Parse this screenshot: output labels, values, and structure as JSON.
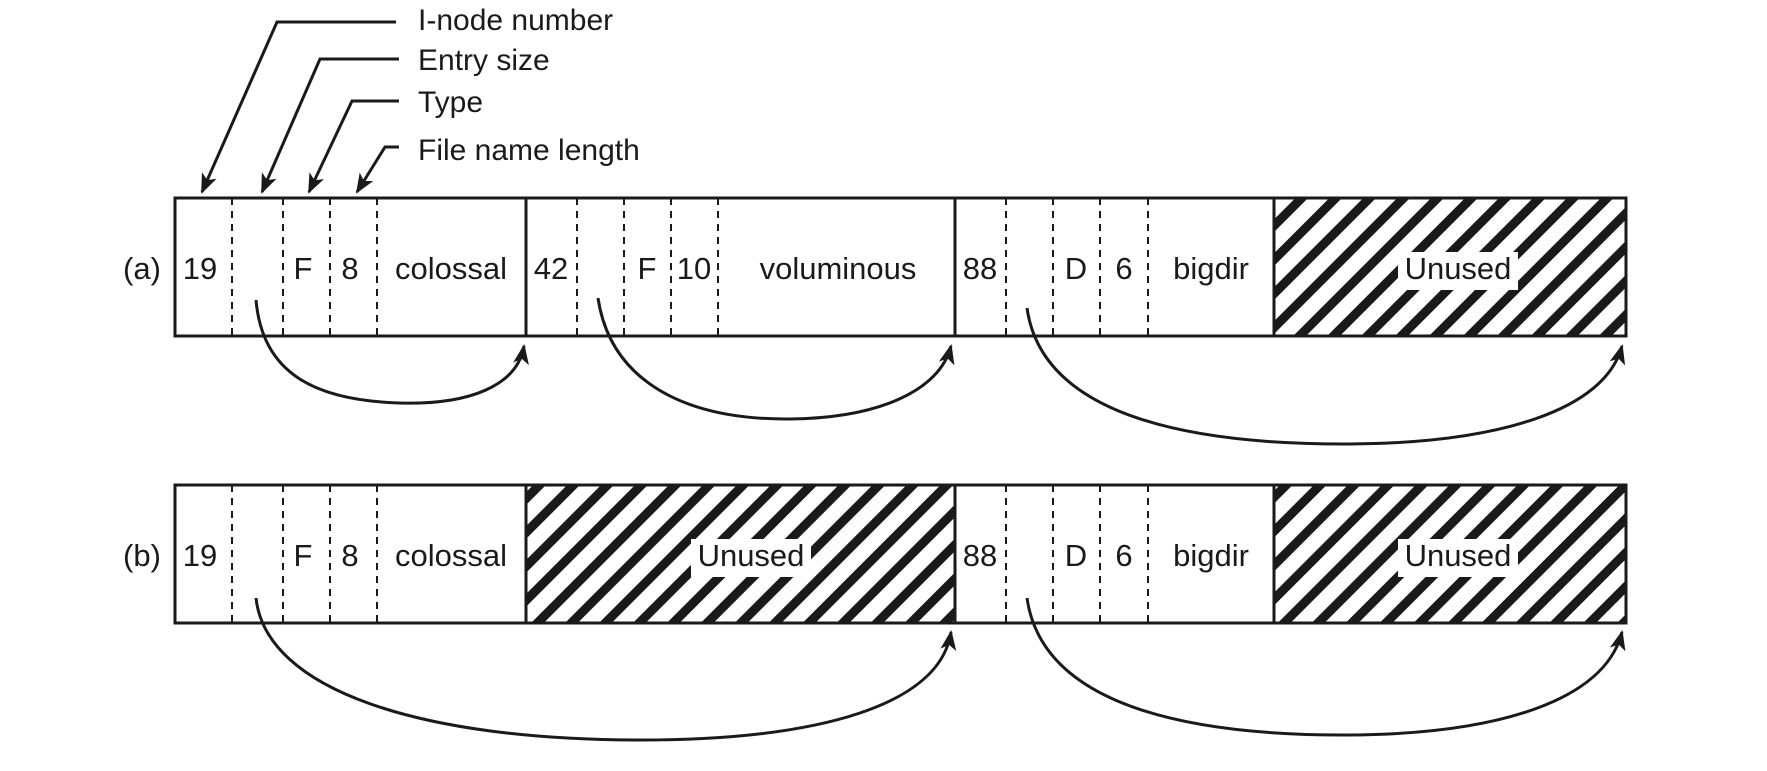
{
  "callouts": {
    "inode": "I-node number",
    "entry_size": "Entry size",
    "type": "Type",
    "name_length": "File name length"
  },
  "row_a": {
    "label": "(a)",
    "entry1": {
      "inode": "19",
      "type": "F",
      "len": "8",
      "name": "colossal"
    },
    "entry2": {
      "inode": "42",
      "type": "F",
      "len": "10",
      "name": "voluminous"
    },
    "entry3": {
      "inode": "88",
      "type": "D",
      "len": "6",
      "name": "bigdir"
    },
    "unused": "Unused"
  },
  "row_b": {
    "label": "(b)",
    "entry1": {
      "inode": "19",
      "type": "F",
      "len": "8",
      "name": "colossal"
    },
    "unused1": "Unused",
    "entry3": {
      "inode": "88",
      "type": "D",
      "len": "6",
      "name": "bigdir"
    },
    "unused2": "Unused"
  }
}
